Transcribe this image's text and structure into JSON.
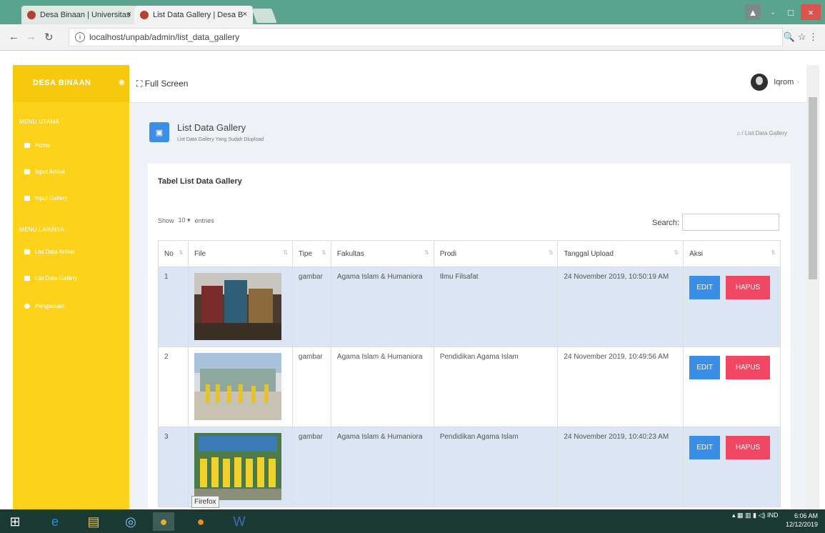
{
  "browser": {
    "tabs": [
      {
        "label": "Desa Binaan | Universitas",
        "close": "×"
      },
      {
        "label": "List Data Gallery | Desa B",
        "close": "×"
      }
    ],
    "url": "localhost/unpab/admin/list_data_gallery",
    "window_buttons": [
      "-",
      "□",
      "×"
    ]
  },
  "app": {
    "brand": "DESA BINAAN",
    "fullscreen_label": "Full Screen",
    "user_name": "Iqrom"
  },
  "sidebar": {
    "menu_utama": "MENU UTAMA",
    "menu_utama_items": [
      {
        "label": "Home",
        "icon": "home-icon"
      },
      {
        "label": "Input Artikel",
        "icon": "user-icon"
      },
      {
        "label": "Input Gallery",
        "icon": "image-icon"
      }
    ],
    "menu_lainnya": "MENU LAINNYA",
    "menu_lainnya_items": [
      {
        "label": "List Data Artikel",
        "icon": "list-icon"
      },
      {
        "label": "List Data Gallery",
        "icon": "image-icon"
      },
      {
        "label": "Pengaduan",
        "icon": "gear-icon"
      }
    ]
  },
  "page": {
    "title": "List Data Gallery",
    "subtitle": "List Data Gallery Yang Sudah Diupload",
    "breadcrumb": "List Data Gallery"
  },
  "table_card": {
    "title": "Tabel List Data Gallery",
    "show_label": "Show",
    "entries_value": "10",
    "entries_label": "entries",
    "search_label": "Search:",
    "columns": [
      "No",
      "File",
      "Tipe",
      "Fakultas",
      "Prodi",
      "Tanggal Upload",
      "Aksi"
    ],
    "rows": [
      {
        "no": "1",
        "tipe": "gambar",
        "fakultas": "Agama Islam & Humaniora",
        "prodi": "Ilmu Filsafat",
        "tanggal": "24 November 2019, 10:50:19 AM"
      },
      {
        "no": "2",
        "tipe": "gambar",
        "fakultas": "Agama Islam & Humaniora",
        "prodi": "Pendidikan Agama Islam",
        "tanggal": "24 November 2019, 10:49:56 AM"
      },
      {
        "no": "3",
        "tipe": "gambar",
        "fakultas": "Agama Islam & Humaniora",
        "prodi": "Pendidikan Agama Islam",
        "tanggal": "24 November 2019, 10:40:23 AM"
      }
    ],
    "edit_label": "EDIT",
    "hapus_label": "HAPUS"
  },
  "tooltip": "Firefox",
  "taskbar": {
    "lang": "IND",
    "time": "6:06 AM",
    "date": "12/12/2019"
  }
}
